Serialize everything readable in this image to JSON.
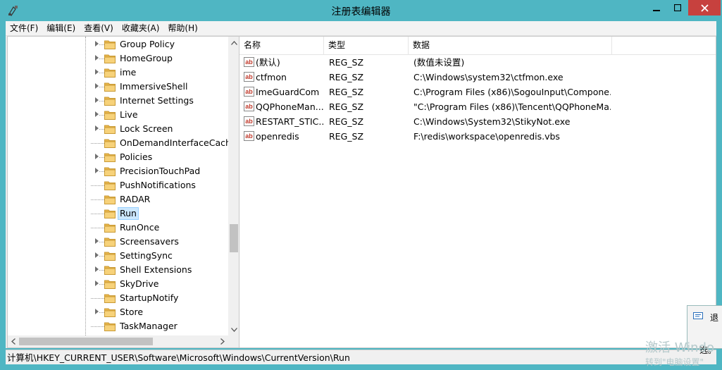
{
  "window": {
    "title": "注册表编辑器",
    "accent": "#4fb6c3",
    "close_color": "#c7413e",
    "icons": {
      "app": "regedit-icon",
      "minimize": "minimize-icon",
      "maximize": "maximize-icon",
      "close": "close-icon"
    }
  },
  "menu": [
    "文件(F)",
    "编辑(E)",
    "查看(V)",
    "收藏夹(A)",
    "帮助(H)"
  ],
  "tree": {
    "items": [
      {
        "label": "Group Policy",
        "expandable": true
      },
      {
        "label": "HomeGroup",
        "expandable": true
      },
      {
        "label": "ime",
        "expandable": true
      },
      {
        "label": "ImmersiveShell",
        "expandable": true
      },
      {
        "label": "Internet Settings",
        "expandable": true
      },
      {
        "label": "Live",
        "expandable": true
      },
      {
        "label": "Lock Screen",
        "expandable": true
      },
      {
        "label": "OnDemandInterfaceCache",
        "expandable": false
      },
      {
        "label": "Policies",
        "expandable": true
      },
      {
        "label": "PrecisionTouchPad",
        "expandable": true
      },
      {
        "label": "PushNotifications",
        "expandable": false
      },
      {
        "label": "RADAR",
        "expandable": false
      },
      {
        "label": "Run",
        "expandable": false,
        "selected": true
      },
      {
        "label": "RunOnce",
        "expandable": false
      },
      {
        "label": "Screensavers",
        "expandable": true
      },
      {
        "label": "SettingSync",
        "expandable": true
      },
      {
        "label": "Shell Extensions",
        "expandable": true
      },
      {
        "label": "SkyDrive",
        "expandable": true
      },
      {
        "label": "StartupNotify",
        "expandable": false
      },
      {
        "label": "Store",
        "expandable": true
      },
      {
        "label": "TaskManager",
        "expandable": false
      }
    ],
    "selection_color": "#cce8ff",
    "icons": {
      "folder": "folder-icon",
      "expander": "expand-arrow-icon"
    }
  },
  "list": {
    "columns": [
      "名称",
      "类型",
      "数据"
    ],
    "rows": [
      {
        "name": "(默认)",
        "type": "REG_SZ",
        "data": "(数值未设置)"
      },
      {
        "name": "ctfmon",
        "type": "REG_SZ",
        "data": "C:\\Windows\\system32\\ctfmon.exe"
      },
      {
        "name": "ImeGuardCom",
        "type": "REG_SZ",
        "data": "C:\\Program Files (x86)\\SogouInput\\Compone..."
      },
      {
        "name": "QQPhoneMan...",
        "type": "REG_SZ",
        "data": "\"C:\\Program Files (x86)\\Tencent\\QQPhoneMa..."
      },
      {
        "name": "RESTART_STIC...",
        "type": "REG_SZ",
        "data": "C:\\Windows\\System32\\StikyNot.exe"
      },
      {
        "name": "openredis",
        "type": "REG_SZ",
        "data": "F:\\redis\\workspace\\openredis.vbs"
      }
    ],
    "icon": "string-value-icon"
  },
  "statusbar": {
    "path": "计算机\\HKEY_CURRENT_USER\\Software\\Microsoft\\Windows\\CurrentVersion\\Run"
  },
  "notification": {
    "title": "退",
    "text": "选。"
  },
  "watermark": {
    "line1": "激活 Windo",
    "line2": "转到\"电脑设置\""
  }
}
